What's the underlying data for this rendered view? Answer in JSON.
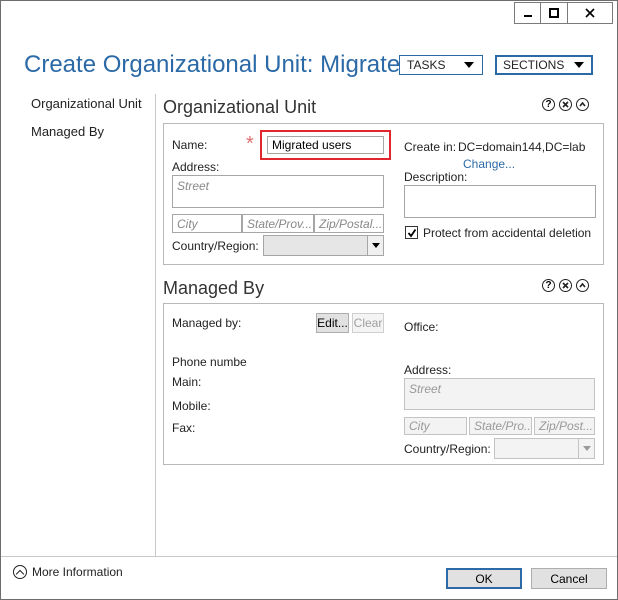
{
  "window": {
    "title": "Create Organizational Unit: Migrate...",
    "tasks_label": "TASKS",
    "sections_label": "SECTIONS"
  },
  "nav": {
    "items": [
      "Organizational Unit",
      "Managed By"
    ]
  },
  "ou_section": {
    "title": "Organizational Unit",
    "name_label": "Name:",
    "required_mark": "*",
    "name_value": "Migrated users",
    "address_label": "Address:",
    "street_placeholder": "Street",
    "city_placeholder": "City",
    "state_placeholder": "State/Prov...",
    "zip_placeholder": "Zip/Postal...",
    "country_label": "Country/Region:",
    "create_in_label": "Create in:",
    "create_in_value": "DC=domain144,DC=lab",
    "change_link": "Change...",
    "description_label": "Description:",
    "protect_label": "Protect from accidental deletion",
    "protect_checked": true
  },
  "managed_section": {
    "title": "Managed By",
    "managed_by_label": "Managed by:",
    "edit_button": "Edit...",
    "clear_button": "Clear",
    "phone_label": "Phone numbe",
    "main_label": "Main:",
    "mobile_label": "Mobile:",
    "fax_label": "Fax:",
    "office_label": "Office:",
    "address_label": "Address:",
    "street_placeholder": "Street",
    "city_placeholder": "City",
    "state_placeholder": "State/Pro...",
    "zip_placeholder": "Zip/Post...",
    "country_label": "Country/Region:"
  },
  "footer": {
    "more_info": "More Information",
    "ok_button": "OK",
    "cancel_button": "Cancel"
  },
  "colors": {
    "accent": "#2b6aa6",
    "highlight": "#e0262e",
    "required": "#e07070"
  }
}
